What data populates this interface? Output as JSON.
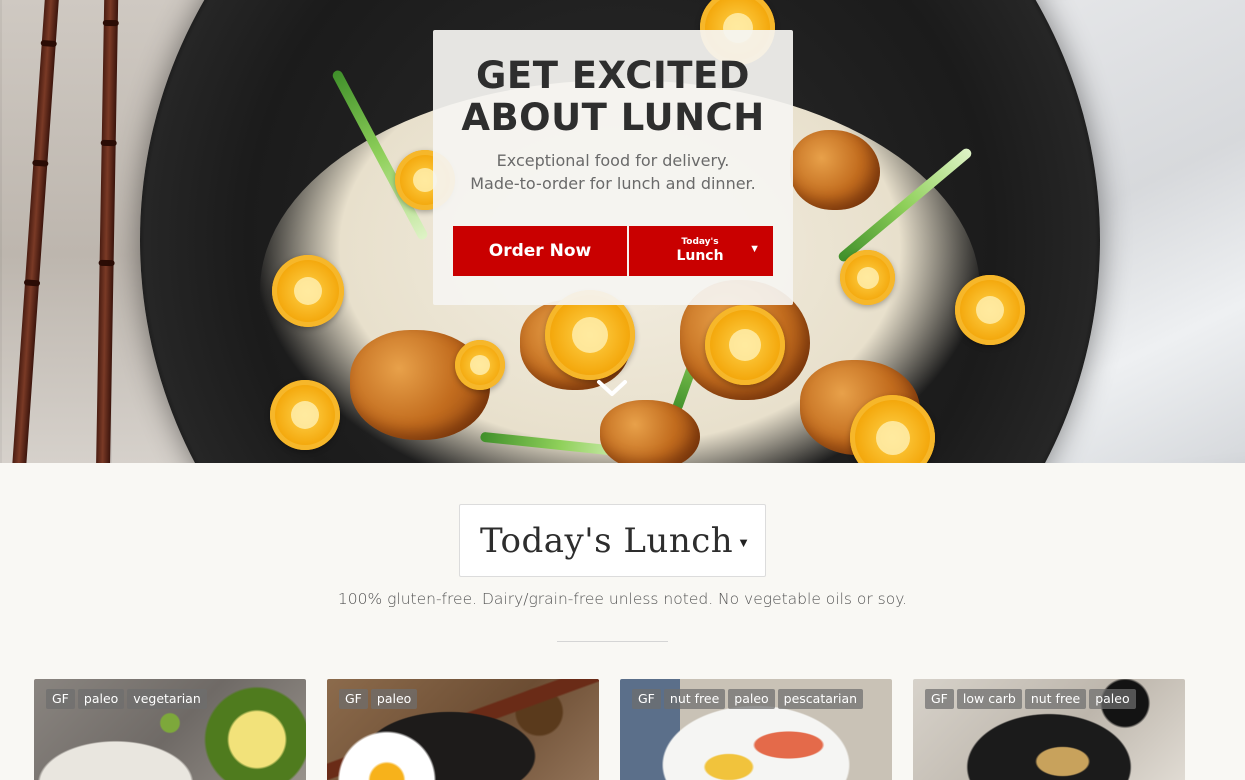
{
  "hero": {
    "title": "GET EXCITED\nABOUT LUNCH",
    "subtitle_line1": "Exceptional food for delivery.",
    "subtitle_line2": "Made-to-order for lunch and dinner.",
    "order_button": "Order Now",
    "menu_button_small": "Today's",
    "menu_button_large": "Lunch",
    "menu_button_caret": "▼"
  },
  "menu_selector": {
    "label": "Today's Lunch",
    "caret": "▼"
  },
  "notice": "100% gluten-free. Dairy/grain-free unless noted. No vegetable oils or soy.",
  "dishes": [
    {
      "tags": [
        "GF",
        "paleo",
        "vegetarian"
      ]
    },
    {
      "tags": [
        "GF",
        "paleo"
      ]
    },
    {
      "tags": [
        "GF",
        "nut free",
        "paleo",
        "pescatarian"
      ]
    },
    {
      "tags": [
        "GF",
        "low carb",
        "nut free",
        "paleo"
      ]
    }
  ],
  "colors": {
    "accent_red": "#c90000",
    "page_background": "#f9f8f4"
  },
  "icons": {
    "scroll": "chevron-down-icon"
  }
}
